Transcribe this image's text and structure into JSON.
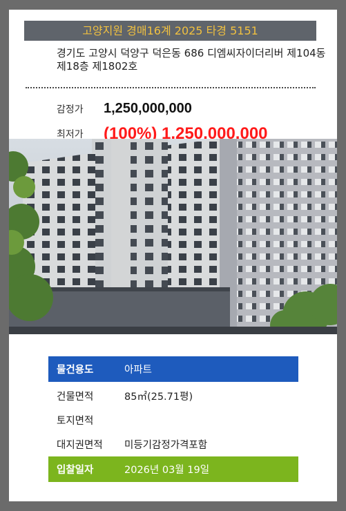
{
  "case": {
    "title": "고양지원 경매16계 2025 타경 5151"
  },
  "address": "경기도 고양시 덕양구 덕은동 686 디엠씨자이더리버 제104동 제18층 제1802호",
  "prices": {
    "appraisal_label": "감정가",
    "appraisal_value": "1,250,000,000",
    "minimum_label": "최저가",
    "minimum_value": "(100%) 1,250,000,000"
  },
  "colors": {
    "banner_bg": "#5f646b",
    "banner_text": "#f0c040",
    "min_price": "#ff1a1a",
    "head_row": "#1e5bbd",
    "bid_row": "#7cb51e"
  },
  "details": {
    "usage_label": "물건용도",
    "usage_value": "아파트",
    "building_area_label": "건물면적",
    "building_area_value": "85㎡(25.71평)",
    "land_area_label": "토지면적",
    "land_area_value": "",
    "land_right_label": "대지권면적",
    "land_right_value": "미등기감정가격포함",
    "bid_date_label": "입찰일자",
    "bid_date_value": "2026년 03월 19일"
  }
}
